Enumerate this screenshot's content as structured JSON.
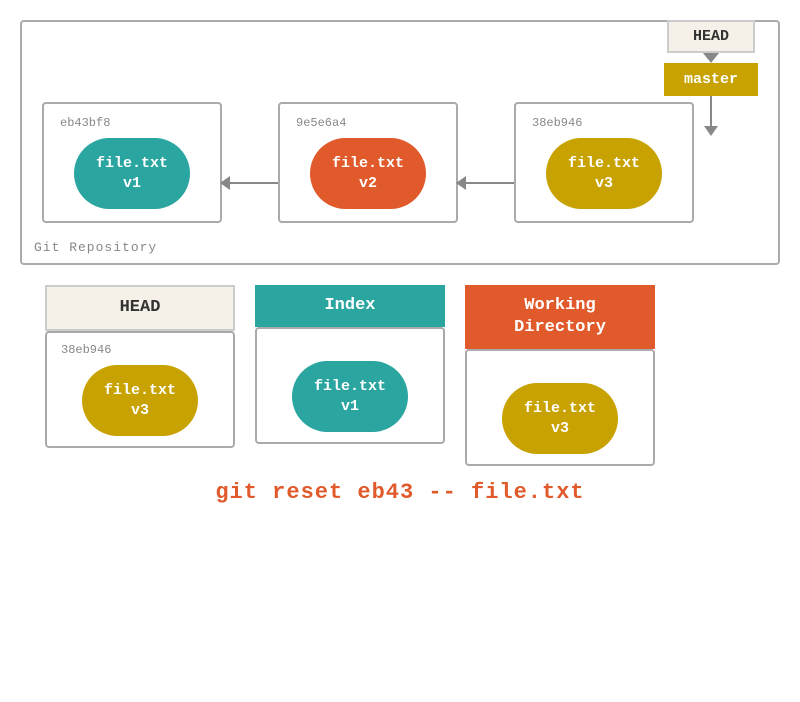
{
  "repo": {
    "label": "Git Repository",
    "head_label": "HEAD",
    "master_label": "master",
    "commits": [
      {
        "id": "eb43bf8",
        "file": "file.txt",
        "version": "v1",
        "color": "teal"
      },
      {
        "id": "9e5e6a4",
        "file": "file.txt",
        "version": "v2",
        "color": "orange"
      },
      {
        "id": "38eb946",
        "file": "file.txt",
        "version": "v3",
        "color": "yellow"
      }
    ]
  },
  "areas": [
    {
      "name": "HEAD",
      "label_class": "area-label-head",
      "commit_id": "38eb946",
      "file": "file.txt",
      "version": "v3",
      "blob_color": "yellow"
    },
    {
      "name": "Index",
      "label_class": "area-label-index",
      "commit_id": "",
      "file": "file.txt",
      "version": "v1",
      "blob_color": "teal"
    },
    {
      "name": "Working\nDirectory",
      "label_class": "area-label-workdir",
      "commit_id": "",
      "file": "file.txt",
      "version": "v3",
      "blob_color": "yellow"
    }
  ],
  "command": "git reset eb43 -- file.txt"
}
